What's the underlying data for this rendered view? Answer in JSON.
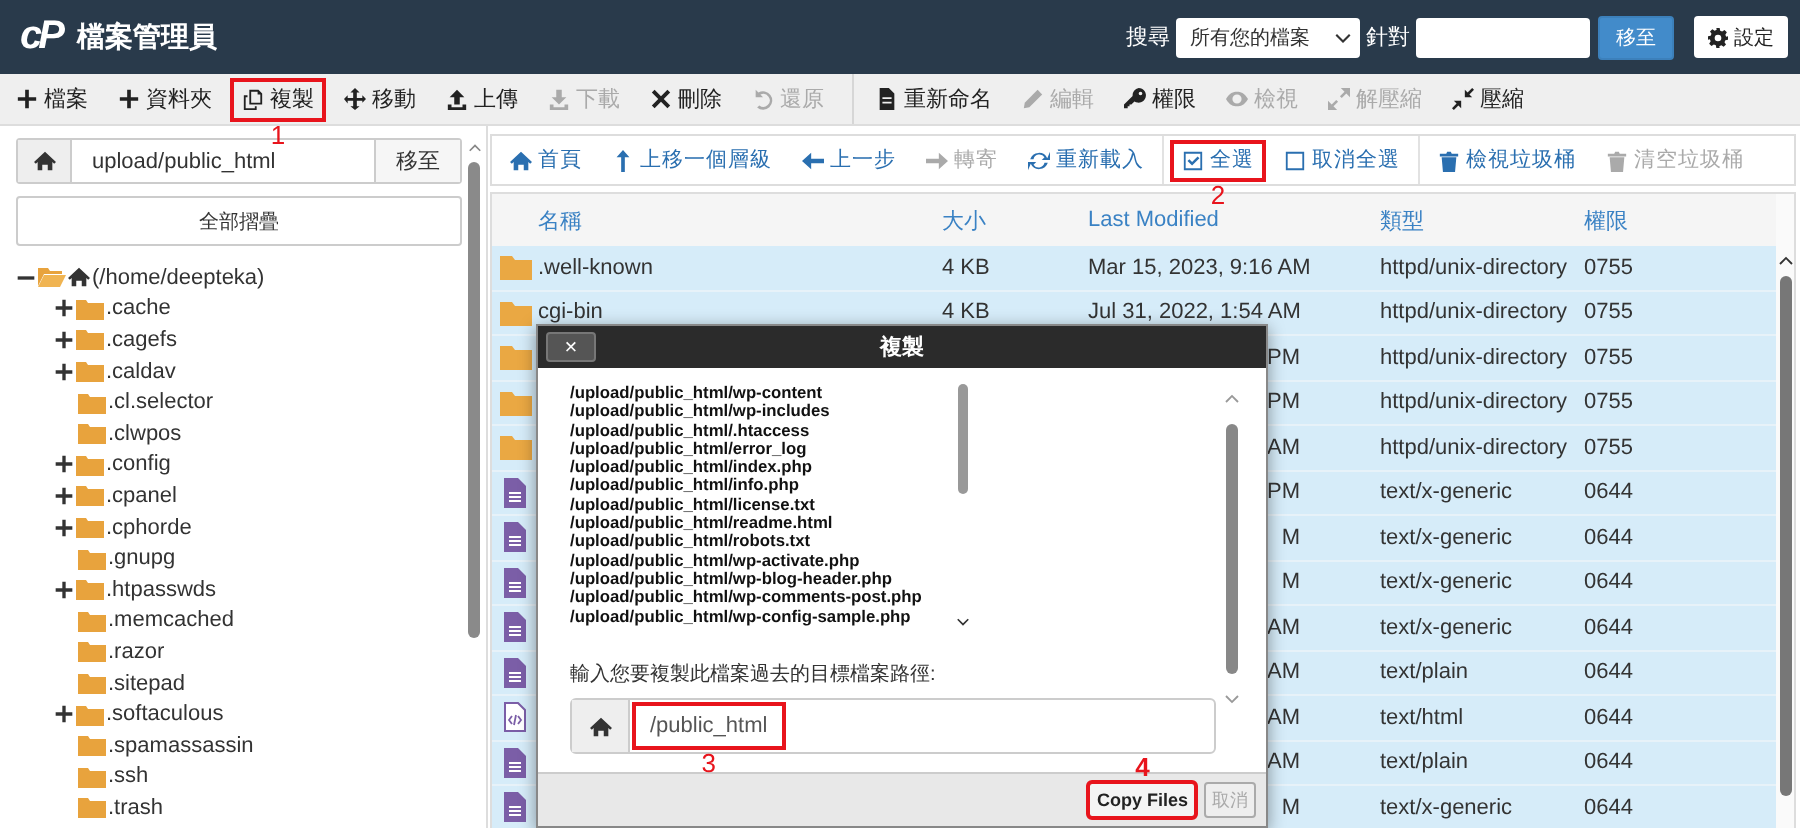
{
  "header": {
    "logo": "cP",
    "title": "檔案管理員",
    "search_label": "搜尋",
    "search_scope": "所有您的檔案",
    "for_label": "針對",
    "go_button": "移至",
    "settings_button": "設定"
  },
  "toolbar": {
    "groups": [
      [
        {
          "label": "檔案",
          "disabled": false
        },
        {
          "label": "資料夾",
          "disabled": false
        },
        {
          "label": "複製",
          "disabled": false,
          "callout": "1"
        },
        {
          "label": "移動",
          "disabled": false
        },
        {
          "label": "上傳",
          "disabled": false
        },
        {
          "label": "下載",
          "disabled": true
        },
        {
          "label": "刪除",
          "disabled": false
        },
        {
          "label": "還原",
          "disabled": true
        }
      ],
      [
        {
          "label": "重新命名",
          "disabled": false
        },
        {
          "label": "編輯",
          "disabled": true
        },
        {
          "label": "權限",
          "disabled": false
        },
        {
          "label": "檢視",
          "disabled": true
        },
        {
          "label": "解壓縮",
          "disabled": true
        },
        {
          "label": "壓縮",
          "disabled": false
        }
      ]
    ]
  },
  "sidebar": {
    "path": "upload/public_html",
    "go_button": "移至",
    "collapse_button": "全部摺疊",
    "tree": {
      "label": "(/home/deepteka)",
      "expanded": true,
      "children": [
        {
          "label": ".cache",
          "expandable": true
        },
        {
          "label": ".cagefs",
          "expandable": true
        },
        {
          "label": ".caldav",
          "expandable": true
        },
        {
          "label": ".cl.selector",
          "expandable": false
        },
        {
          "label": ".clwpos",
          "expandable": false
        },
        {
          "label": ".config",
          "expandable": true
        },
        {
          "label": ".cpanel",
          "expandable": true
        },
        {
          "label": ".cphorde",
          "expandable": true
        },
        {
          "label": ".gnupg",
          "expandable": false
        },
        {
          "label": ".htpasswds",
          "expandable": true
        },
        {
          "label": ".memcached",
          "expandable": false
        },
        {
          "label": ".razor",
          "expandable": false
        },
        {
          "label": ".sitepad",
          "expandable": false
        },
        {
          "label": ".softaculous",
          "expandable": true
        },
        {
          "label": ".spamassassin",
          "expandable": false
        },
        {
          "label": ".ssh",
          "expandable": false
        },
        {
          "label": ".trash",
          "expandable": false
        }
      ]
    }
  },
  "nav": {
    "groups": [
      [
        {
          "label": "首頁",
          "disabled": false
        },
        {
          "label": "上移一個層級",
          "disabled": false
        },
        {
          "label": "上一步",
          "disabled": false
        },
        {
          "label": "轉寄",
          "disabled": true
        },
        {
          "label": "重新載入",
          "disabled": false
        }
      ],
      [
        {
          "label": "全選",
          "disabled": false,
          "callout": "2"
        },
        {
          "label": "取消全選",
          "disabled": false
        }
      ],
      [
        {
          "label": "檢視垃圾桶",
          "disabled": false
        },
        {
          "label": "清空垃圾桶",
          "disabled": true
        }
      ]
    ]
  },
  "table": {
    "columns": [
      "名稱",
      "大小",
      "Last Modified",
      "類型",
      "權限"
    ],
    "rows": [
      {
        "kind": "folder",
        "selected": true,
        "name": ".well-known",
        "size": "4 KB",
        "modified": "Mar 15, 2023, 9:16 AM",
        "type": "httpd/unix-directory",
        "permissions": "0755"
      },
      {
        "kind": "folder",
        "selected": true,
        "name": "cgi-bin",
        "size": "4 KB",
        "modified": "Jul 31, 2022, 1:54 AM",
        "type": "httpd/unix-directory",
        "permissions": "0755"
      },
      {
        "kind": "folder",
        "selected": true,
        "modified": "PM",
        "type": "httpd/unix-directory",
        "permissions": "0755"
      },
      {
        "kind": "folder",
        "selected": true,
        "modified": "PM",
        "type": "httpd/unix-directory",
        "permissions": "0755"
      },
      {
        "kind": "folder",
        "selected": true,
        "modified": "AM",
        "type": "httpd/unix-directory",
        "permissions": "0755"
      },
      {
        "kind": "file",
        "selected": true,
        "modified": "PM",
        "type": "text/x-generic",
        "permissions": "0644"
      },
      {
        "kind": "file",
        "selected": true,
        "modified": "M",
        "type": "text/x-generic",
        "permissions": "0644"
      },
      {
        "kind": "file",
        "selected": true,
        "modified": "M",
        "type": "text/x-generic",
        "permissions": "0644"
      },
      {
        "kind": "file",
        "selected": true,
        "modified": "AM",
        "type": "text/x-generic",
        "permissions": "0644"
      },
      {
        "kind": "file",
        "selected": true,
        "modified": "AM",
        "type": "text/plain",
        "permissions": "0644"
      },
      {
        "kind": "code",
        "selected": true,
        "modified": "AM",
        "type": "text/html",
        "permissions": "0644"
      },
      {
        "kind": "file",
        "selected": true,
        "modified": "AM",
        "type": "text/plain",
        "permissions": "0644"
      },
      {
        "kind": "file",
        "selected": true,
        "modified": "M",
        "type": "text/x-generic",
        "permissions": "0644"
      }
    ]
  },
  "dialog": {
    "close": "×",
    "title": "複製",
    "paths": [
      "/upload/public_html/wp-content",
      "/upload/public_html/wp-includes",
      "/upload/public_html/.htaccess",
      "/upload/public_html/error_log",
      "/upload/public_html/index.php",
      "/upload/public_html/info.php",
      "/upload/public_html/license.txt",
      "/upload/public_html/readme.html",
      "/upload/public_html/robots.txt",
      "/upload/public_html/wp-activate.php",
      "/upload/public_html/wp-blog-header.php",
      "/upload/public_html/wp-comments-post.php",
      "/upload/public_html/wp-config-sample.php"
    ],
    "label": "輸入您要複製此檔案過去的目標檔案路徑:",
    "input": {
      "value": "/public_html",
      "callout": "3"
    },
    "buttons": [
      {
        "label": "Copy Files",
        "disabled": false,
        "callout": "4"
      },
      {
        "label": "取消",
        "disabled": true
      }
    ]
  }
}
